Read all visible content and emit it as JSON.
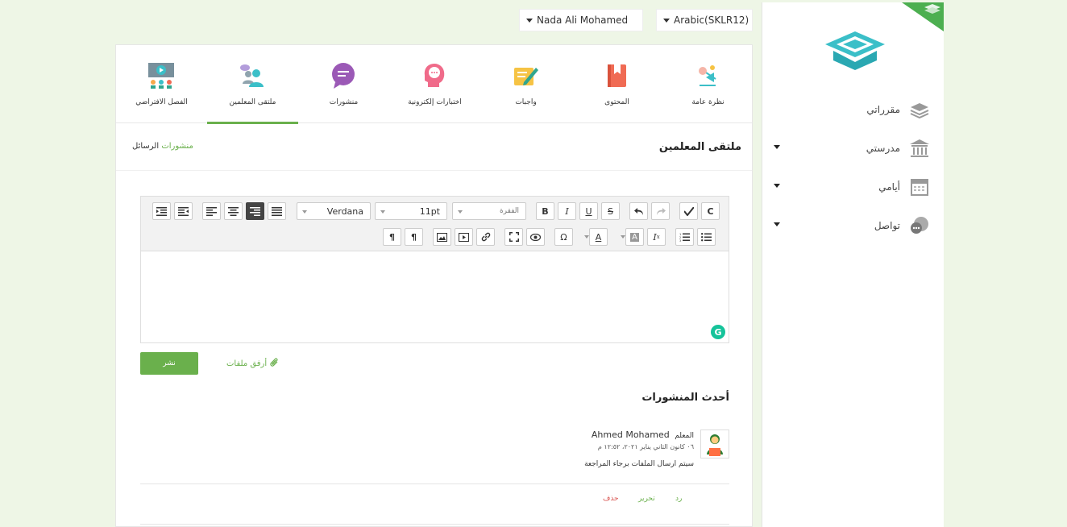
{
  "top": {
    "user_name": "Nada Ali Mohamed",
    "language": "Arabic(SKLR12)"
  },
  "sidebar": {
    "items": [
      {
        "label": "مقرراتي",
        "icon": "books-stack-icon",
        "has_caret": false
      },
      {
        "label": "مدرستي",
        "icon": "school-building-icon",
        "has_caret": true
      },
      {
        "label": "أيامي",
        "icon": "calendar-icon",
        "has_caret": true
      },
      {
        "label": "تواصل",
        "icon": "chat-bubbles-icon",
        "has_caret": true
      }
    ]
  },
  "tabs": [
    {
      "label": "نظرة عامة",
      "icon": "overview-icon"
    },
    {
      "label": "المحتوى",
      "icon": "book-icon"
    },
    {
      "label": "واجبات",
      "icon": "homework-icon"
    },
    {
      "label": "اختبارات إلكترونية",
      "icon": "quiz-head-icon"
    },
    {
      "label": "منشورات",
      "icon": "posts-bubble-icon"
    },
    {
      "label": "ملتقى المعلمين",
      "icon": "teachers-forum-icon"
    },
    {
      "label": "الفصل الافتراضي",
      "icon": "virtual-class-icon"
    }
  ],
  "active_tab": "ملتقى المعلمين",
  "section": {
    "title": "ملتقى المعلمين",
    "crumb_posts": "منشورات",
    "crumb_messages": "الرسائل"
  },
  "editor": {
    "font_family": "Verdana",
    "font_size": "11pt",
    "paragraph": "الفقرة",
    "grammarly": "G"
  },
  "actions": {
    "publish": "نشر",
    "attach": "أرفق ملفات"
  },
  "recent_title": "أحدث المنشورات",
  "post": {
    "author": "Ahmed Mohamed",
    "role": "المعلم",
    "date": "٠٦ كانون الثاني يناير ٢٠٢١، ١٢:٥٢ م",
    "body": "سيتم ارسال الملفات برجاء المراجعة",
    "reply": "رد",
    "edit": "تحرير",
    "delete": "حذف"
  },
  "colors": {
    "accent": "#6ab04c",
    "delete": "#d9534f",
    "background": "#eef6e6"
  }
}
